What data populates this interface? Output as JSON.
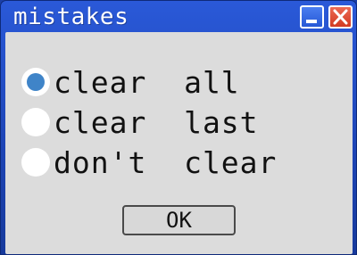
{
  "window": {
    "title": "mistakes"
  },
  "options": [
    {
      "label": "clear  all",
      "selected": true
    },
    {
      "label": "clear  last",
      "selected": false
    },
    {
      "label": "don't  clear",
      "selected": false
    }
  ],
  "buttons": {
    "ok_label": "OK"
  },
  "icons": {
    "minimize": "minimize-icon",
    "close": "close-icon"
  },
  "colors": {
    "titlebar": "#1d44b5",
    "client": "#dcdcdc",
    "close_button": "#d23a22",
    "radio_selected_dot": "#3f84c8"
  }
}
